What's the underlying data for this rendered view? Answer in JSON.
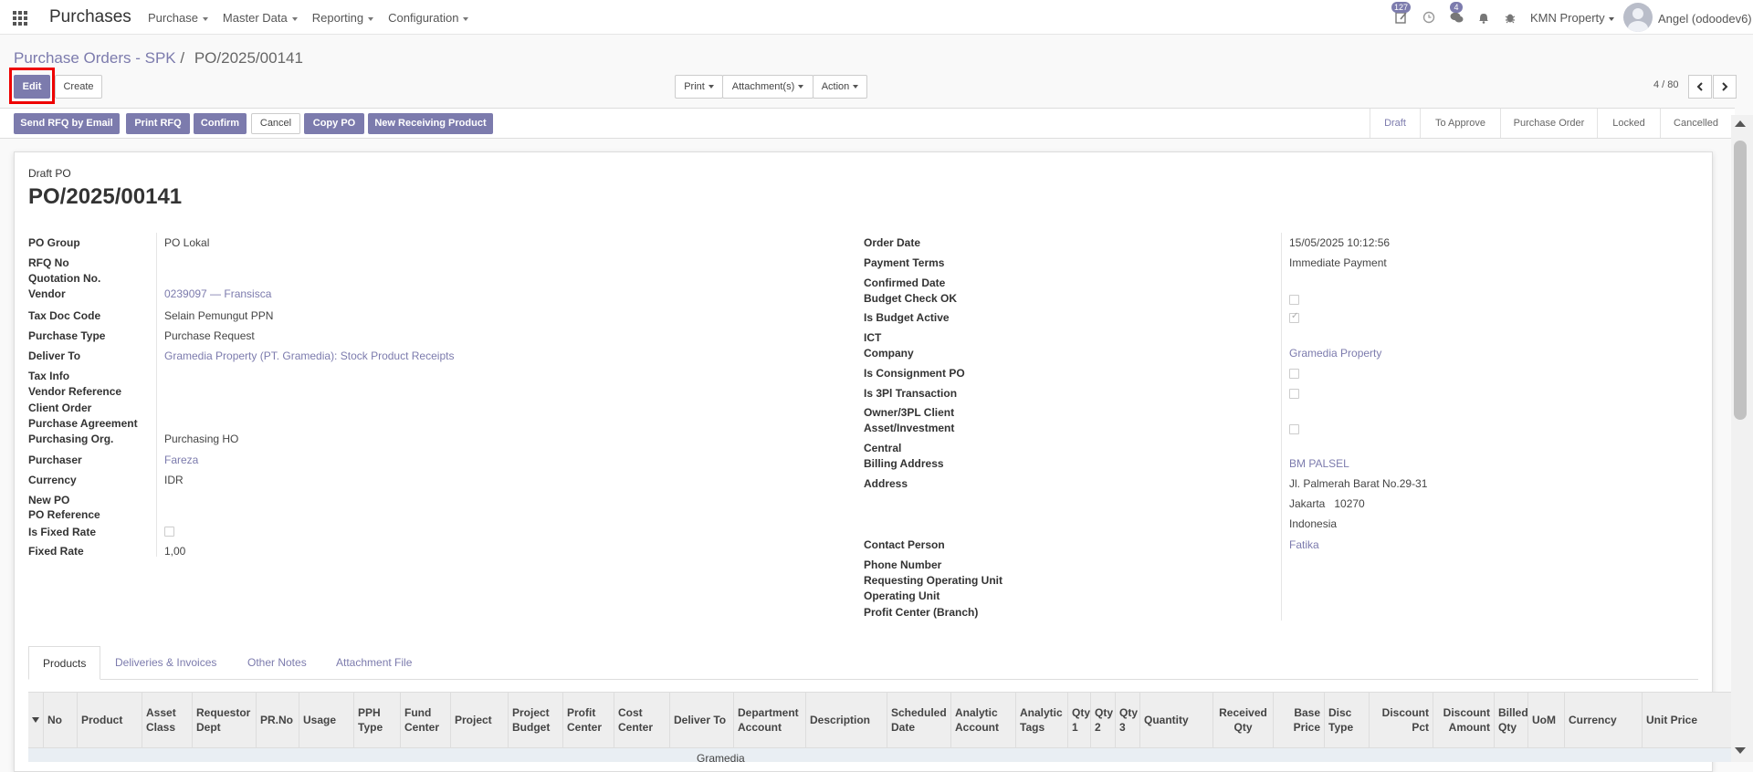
{
  "navbar": {
    "app_title": "Purchases",
    "menus": [
      "Purchase",
      "Master Data",
      "Reporting",
      "Configuration"
    ],
    "activity_badge": "127",
    "messages_badge": "4",
    "company": "KMN Property",
    "user": "Angel (odoodev6)"
  },
  "breadcrumb": {
    "parent": "Purchase Orders - SPK",
    "separator": "/",
    "current": "PO/2025/00141"
  },
  "buttons": {
    "edit": "Edit",
    "create": "Create",
    "print": "Print",
    "attachments": "Attachment(s)",
    "action": "Action"
  },
  "pager": {
    "value": "4 / 80"
  },
  "header_buttons": {
    "send_rfq": "Send RFQ by Email",
    "print_rfq": "Print RFQ",
    "confirm": "Confirm",
    "cancel": "Cancel",
    "copy_po": "Copy PO",
    "new_receiving": "New Receiving Product"
  },
  "statusbar": [
    "Draft",
    "To Approve",
    "Purchase Order",
    "Locked",
    "Cancelled"
  ],
  "statusbar_active": "Draft",
  "form": {
    "subtitle": "Draft PO",
    "title": "PO/2025/00141",
    "left": {
      "po_group_label": "PO Group",
      "po_group": "PO Lokal",
      "rfq_no_label": "RFQ No",
      "quotation_no_label": "Quotation No.",
      "vendor_label": "Vendor",
      "vendor": "0239097 — Fransisca",
      "tax_doc_code_label": "Tax Doc Code",
      "tax_doc_code": "Selain Pemungut PPN",
      "purchase_type_label": "Purchase Type",
      "purchase_type": "Purchase Request",
      "deliver_to_label": "Deliver To",
      "deliver_to": "Gramedia Property (PT. Gramedia): Stock Product Receipts",
      "tax_info_label": "Tax Info",
      "vendor_reference_label": "Vendor Reference",
      "client_order_label": "Client Order",
      "purchase_agreement_label": "Purchase Agreement",
      "purchasing_org_label": "Purchasing Org.",
      "purchasing_org": "Purchasing HO",
      "purchaser_label": "Purchaser",
      "purchaser": "Fareza",
      "currency_label": "Currency",
      "currency": "IDR",
      "new_po_label": "New PO",
      "po_reference_label": "PO Reference",
      "is_fixed_rate_label": "Is Fixed Rate",
      "fixed_rate_label": "Fixed Rate",
      "fixed_rate": "1,00"
    },
    "right": {
      "order_date_label": "Order Date",
      "order_date": "15/05/2025 10:12:56",
      "payment_terms_label": "Payment Terms",
      "payment_terms": "Immediate Payment",
      "confirmed_date_label": "Confirmed Date",
      "budget_check_ok_label": "Budget Check OK",
      "is_budget_active_label": "Is Budget Active",
      "ict_label": "ICT",
      "company_label": "Company",
      "company": "Gramedia Property",
      "is_consignment_po_label": "Is Consignment PO",
      "is_3pl_label": "Is 3Pl Transaction",
      "owner_3pl_label": "Owner/3PL Client",
      "asset_investment_label": "Asset/Investment",
      "central_label": "Central",
      "billing_address_label": "Billing Address",
      "billing_address": "BM PALSEL",
      "address_label": "Address",
      "address_line1": "Jl. Palmerah Barat No.29-31",
      "address_line2": "Jakarta   10270",
      "address_line3": "Indonesia",
      "contact_person_label": "Contact Person",
      "contact_person": "Fatika",
      "phone_number_label": "Phone Number",
      "requesting_ou_label": "Requesting Operating Unit",
      "operating_unit_label": "Operating Unit",
      "profit_center_label": "Profit Center (Branch)"
    },
    "checkboxes": {
      "is_fixed_rate": false,
      "budget_check_ok": false,
      "is_budget_active": true,
      "is_consignment_po": false,
      "is_3pl": false,
      "asset_investment": false
    }
  },
  "tabs": [
    "Products",
    "Deliveries & Invoices",
    "Other Notes",
    "Attachment File"
  ],
  "table": {
    "columns": [
      "No",
      "Product",
      "Asset Class",
      "Requestor Dept",
      "PR.No",
      "Usage",
      "PPH Type",
      "Fund Center",
      "Project",
      "Project Budget",
      "Profit Center",
      "Cost Center",
      "Deliver To",
      "Department Account",
      "Description",
      "Scheduled Date",
      "Analytic Account",
      "Analytic Tags",
      "Qty 1",
      "Qty 2",
      "Qty 3",
      "Quantity",
      "Received Qty",
      "Base Price",
      "Disc Type",
      "Discount Pct",
      "Discount Amount",
      "Billed Qty",
      "UoM",
      "Currency",
      "Unit Price"
    ],
    "first_row_text": "Gramedia"
  }
}
